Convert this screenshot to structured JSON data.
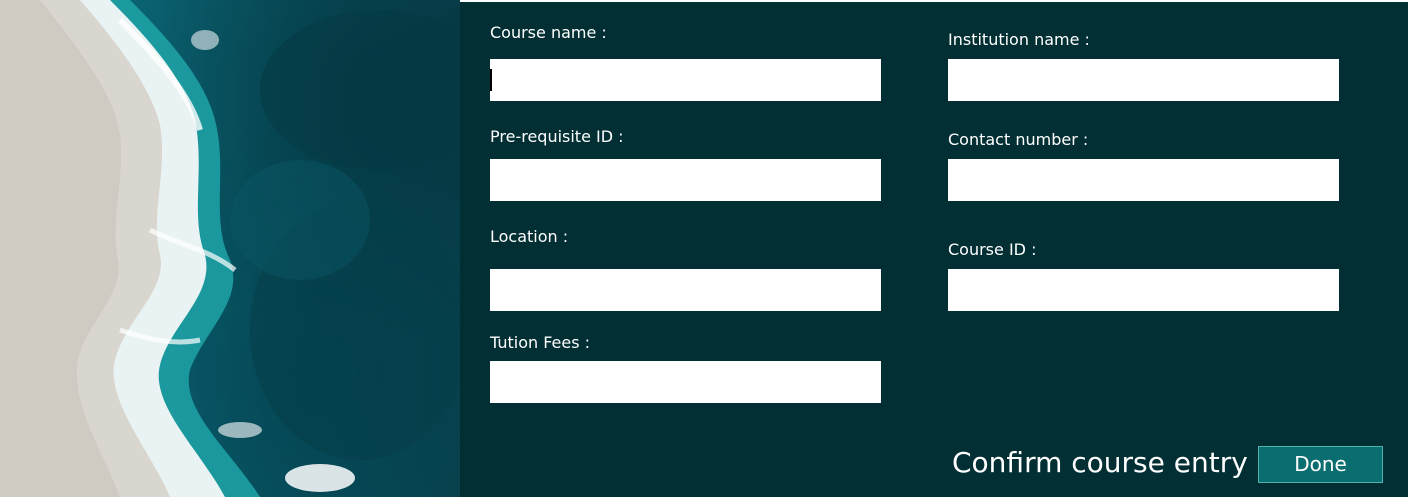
{
  "form": {
    "course_name": {
      "label": "Course name :",
      "value": ""
    },
    "institution_name": {
      "label": "Institution name :",
      "value": ""
    },
    "prerequisite_id": {
      "label": "Pre-requisite ID :",
      "value": ""
    },
    "contact_number": {
      "label": "Contact number :",
      "value": ""
    },
    "location": {
      "label": "Location :",
      "value": ""
    },
    "course_id": {
      "label": "Course ID :",
      "value": ""
    },
    "tuition_fees": {
      "label": "Tution Fees :",
      "value": ""
    }
  },
  "footer": {
    "confirm_text": "Confirm course entry",
    "done_label": "Done"
  },
  "colors": {
    "background": "#022f33",
    "input_background": "#ffffff",
    "button_background": "#0a6d70",
    "button_border": "#4fb3b0",
    "text": "#ffffff"
  }
}
